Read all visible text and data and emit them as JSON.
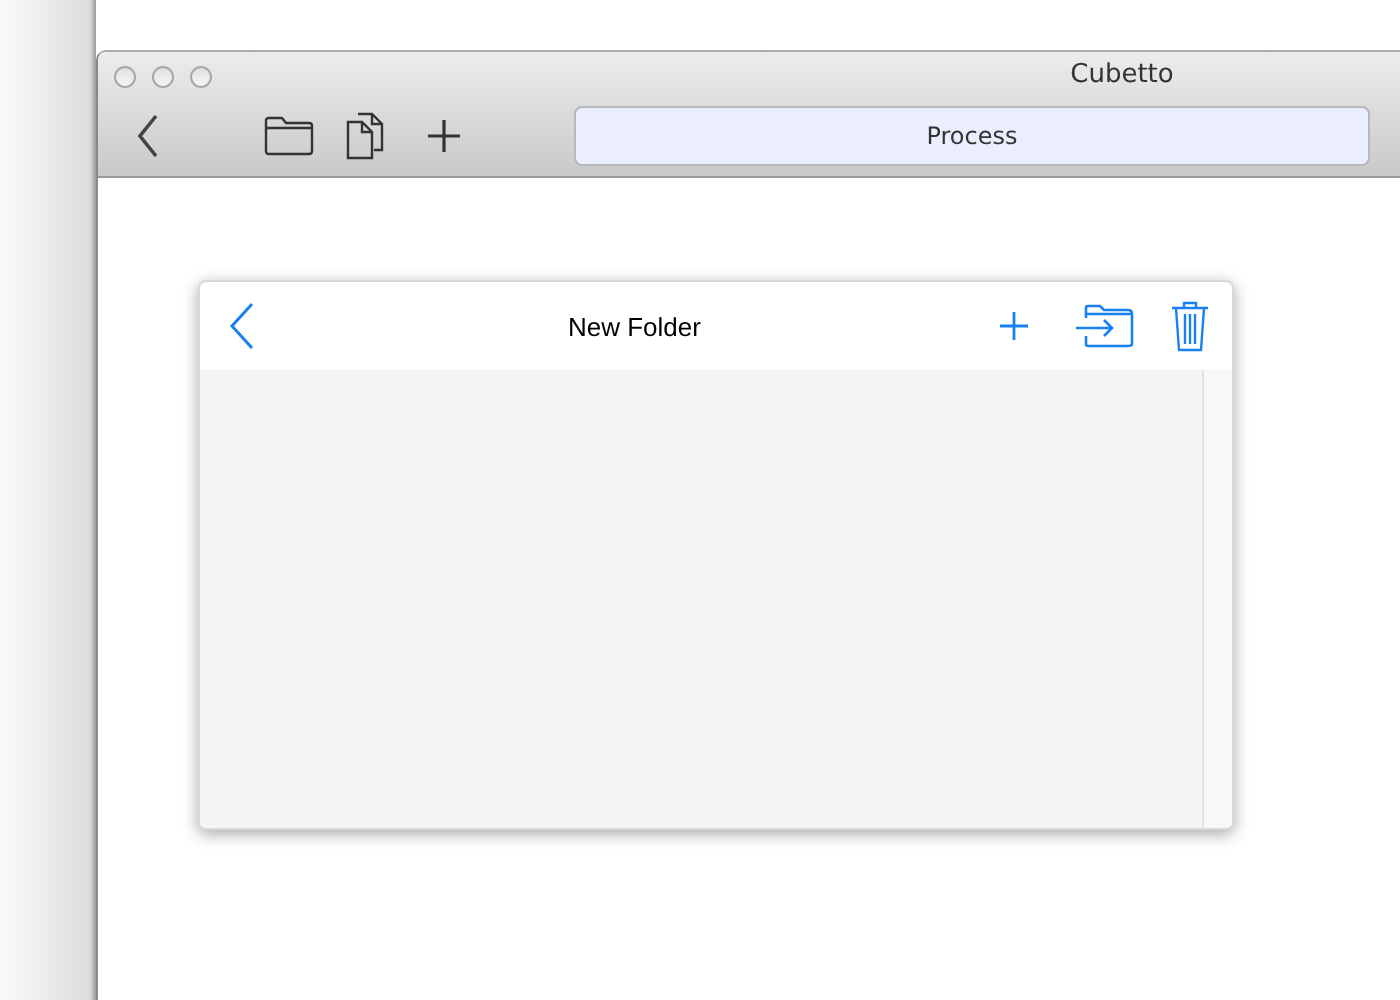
{
  "window": {
    "title": "Cubetto"
  },
  "toolbar": {
    "field": {
      "value": "Process"
    }
  },
  "panel": {
    "title": "New Folder"
  }
}
